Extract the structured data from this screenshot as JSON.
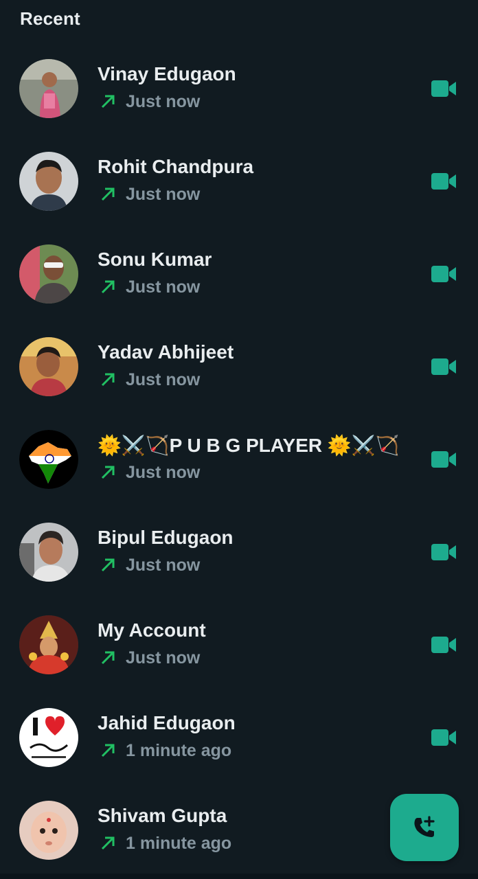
{
  "section_title": "Recent",
  "colors": {
    "background": "#111b21",
    "accent": "#21c063",
    "outgoing_arrow": "#21c063",
    "secondary_text": "#8696a0"
  },
  "calls": [
    {
      "name": "Vinay Edugaon",
      "time": "Just now",
      "direction": "outgoing-arrow-icon",
      "type": "video-call-icon"
    },
    {
      "name": "Rohit Chandpura",
      "time": "Just now",
      "direction": "outgoing-arrow-icon",
      "type": "video-call-icon"
    },
    {
      "name": "Sonu Kumar",
      "time": "Just now",
      "direction": "outgoing-arrow-icon",
      "type": "video-call-icon"
    },
    {
      "name": "Yadav Abhijeet",
      "time": "Just now",
      "direction": "outgoing-arrow-icon",
      "type": "video-call-icon"
    },
    {
      "name": "🌞⚔️🏹P U B G PLAYER 🌞⚔️🏹",
      "time": "Just now",
      "direction": "outgoing-arrow-icon",
      "type": "video-call-icon"
    },
    {
      "name": "Bipul Edugaon",
      "time": "Just now",
      "direction": "outgoing-arrow-icon",
      "type": "video-call-icon"
    },
    {
      "name": "My Account",
      "time": "Just now",
      "direction": "outgoing-arrow-icon",
      "type": "video-call-icon"
    },
    {
      "name": "Jahid Edugaon",
      "time": "1 minute ago",
      "direction": "outgoing-arrow-icon",
      "type": "video-call-icon"
    },
    {
      "name": "Shivam Gupta",
      "time": "1 minute ago",
      "direction": "outgoing-arrow-icon",
      "type": "video-call-icon"
    }
  ],
  "fab": {
    "icon": "add-call-icon"
  }
}
